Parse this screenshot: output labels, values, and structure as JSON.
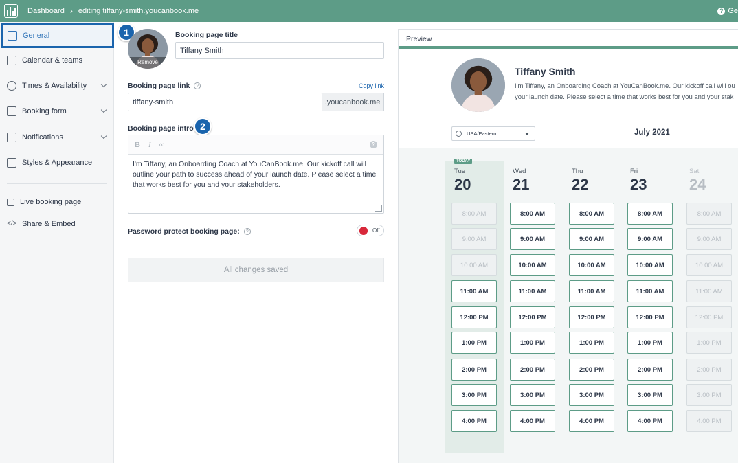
{
  "topbar": {
    "dashboard": "Dashboard",
    "editing_prefix": "editing",
    "editing_link": "tiffany-smith.youcanbook.me",
    "help_text": "Ge"
  },
  "sidebar": {
    "items": [
      {
        "label": "General",
        "icon": "id-card-icon",
        "active": true
      },
      {
        "label": "Calendar & teams",
        "icon": "calendar-user-icon"
      },
      {
        "label": "Times & Availability",
        "icon": "watch-icon"
      },
      {
        "label": "Booking form",
        "icon": "form-icon"
      },
      {
        "label": "Notifications",
        "icon": "envelope-icon"
      },
      {
        "label": "Styles & Appearance",
        "icon": "paint-roller-icon"
      },
      {
        "label": "Live booking page",
        "icon": "external-link-icon"
      },
      {
        "label": "Share & Embed",
        "icon": "code-icon"
      }
    ]
  },
  "badges": {
    "one": "1",
    "two": "2"
  },
  "form": {
    "remove_label": "Remove",
    "title_label": "Booking page title",
    "title_value": "Tiffany Smith",
    "link_label": "Booking page link",
    "copy_link": "Copy link",
    "link_value": "tiffany-smith",
    "link_suffix": ".youcanbook.me",
    "intro_label": "Booking page intro",
    "intro_text": "I'm Tiffany, an Onboarding Coach at YouCanBook.me. Our kickoff call will outline your path to success ahead of your launch date. Please select a time that works best for you and your stakeholders.",
    "password_label": "Password protect booking page:",
    "toggle_state": "Off",
    "saved_label": "All changes saved"
  },
  "preview": {
    "header": "Preview",
    "name": "Tiffany Smith",
    "desc_line1": "I'm Tiffany, an Onboarding Coach at YouCanBook.me. Our kickoff call will ou",
    "desc_line2": "your launch date. Please select a time that works best for you and your stak",
    "timezone": "USA/Eastern",
    "month": "July 2021",
    "today_tag": "TODAY",
    "days": [
      {
        "dow": "Tue",
        "num": "20",
        "today": true,
        "muted": false
      },
      {
        "dow": "Wed",
        "num": "21",
        "today": false,
        "muted": false
      },
      {
        "dow": "Thu",
        "num": "22",
        "today": false,
        "muted": false
      },
      {
        "dow": "Fri",
        "num": "23",
        "today": false,
        "muted": false
      },
      {
        "dow": "Sat",
        "num": "24",
        "today": false,
        "muted": true
      }
    ],
    "slots": [
      "8:00 AM",
      "9:00 AM",
      "10:00 AM",
      "11:00 AM",
      "12:00 PM",
      "1:00 PM",
      "2:00 PM",
      "3:00 PM",
      "4:00 PM"
    ]
  }
}
